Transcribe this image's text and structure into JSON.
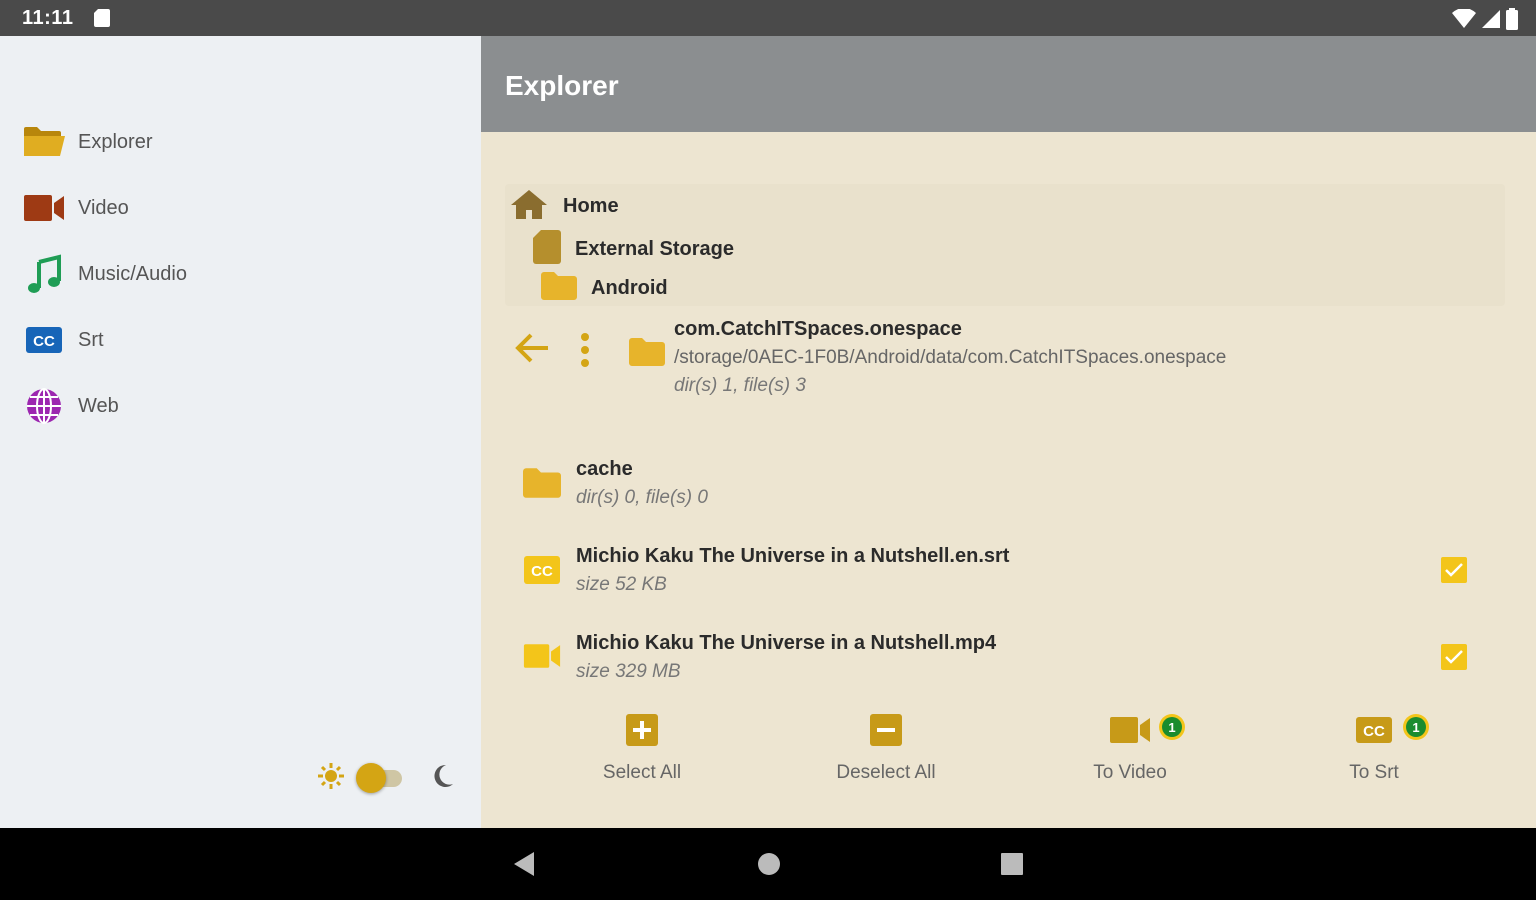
{
  "status_bar": {
    "time": "11:11"
  },
  "drawer": {
    "items": [
      {
        "label": "Explorer",
        "icon": "folder-open-icon"
      },
      {
        "label": "Video",
        "icon": "videocam-icon"
      },
      {
        "label": "Music/Audio",
        "icon": "music-note-icon"
      },
      {
        "label": "Srt",
        "icon": "closed-caption-icon"
      },
      {
        "label": "Web",
        "icon": "globe-icon"
      }
    ],
    "theme_toggle": {
      "mode": "light"
    }
  },
  "appbar": {
    "title": "Explorer"
  },
  "breadcrumbs": [
    {
      "label": "Home",
      "icon": "home-icon"
    },
    {
      "label": "External Storage",
      "icon": "sd-card-icon"
    },
    {
      "label": "Android",
      "icon": "folder-icon"
    }
  ],
  "current_folder": {
    "name": "com.CatchITSpaces.onespace",
    "path": "/storage/0AEC-1F0B/Android/data/com.CatchITSpaces.onespace",
    "meta": "dir(s) 1, file(s) 3"
  },
  "files": [
    {
      "name": "cache",
      "meta": "dir(s) 0, file(s) 0",
      "icon": "folder-icon",
      "checked": null
    },
    {
      "name": "Michio Kaku The Universe in a Nutshell.en.srt",
      "meta": "size 52 KB",
      "icon": "closed-caption-icon",
      "checked": true
    },
    {
      "name": "Michio Kaku The Universe in a Nutshell.mp4",
      "meta": "size 329 MB",
      "icon": "videocam-icon",
      "checked": true
    }
  ],
  "actions": [
    {
      "label": "Select All",
      "icon": "add-box-icon"
    },
    {
      "label": "Deselect All",
      "icon": "minus-box-icon"
    },
    {
      "label": "To Video",
      "icon": "videocam-icon",
      "badge": "1"
    },
    {
      "label": "To Srt",
      "icon": "closed-caption-icon",
      "badge": "1"
    }
  ],
  "colors": {
    "accent": "#d4a514",
    "appbar": "#8b8e90",
    "drawer_bg": "#edf0f3",
    "content_bg": "#ede5d1",
    "badge_green": "#1b8c2e"
  }
}
